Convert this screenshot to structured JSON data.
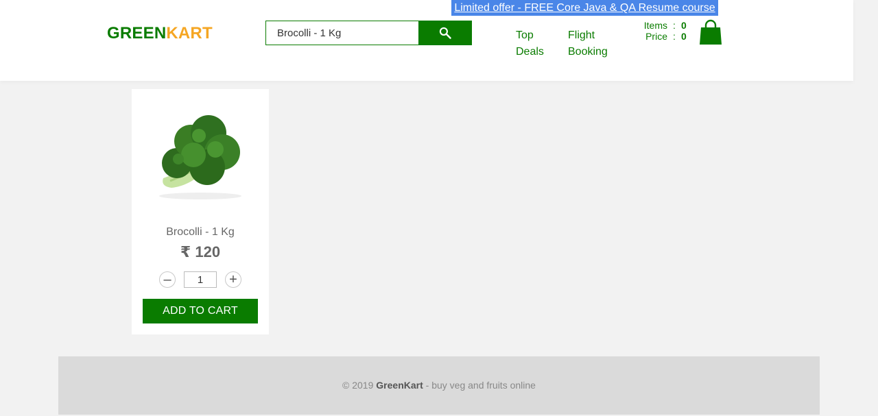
{
  "offer": {
    "text": "Limited offer - FREE Core Java & QA Resume course"
  },
  "brand": {
    "green": "GREEN",
    "kart": "KART",
    "colors": {
      "green": "#0a7c00",
      "orange": "#f5a623"
    }
  },
  "search": {
    "value": "Brocolli - 1 Kg",
    "placeholder": "Search for Vegetables and Fruits",
    "icon": "search-icon"
  },
  "nav": {
    "top_deals_line1": "Top",
    "top_deals_line2": "Deals",
    "flight_line1": "Flight",
    "flight_line2": "Booking"
  },
  "cart": {
    "items_label": "Items",
    "items_value": "0",
    "price_label": "Price",
    "price_value": "0",
    "separator": ":",
    "icon": "shopping-bag-icon"
  },
  "product": {
    "name": "Brocolli - 1 Kg",
    "price": "₹ 120",
    "quantity": "1",
    "decrement": "–",
    "increment": "+",
    "add_to_cart": "ADD TO CART",
    "image": "broccoli-image"
  },
  "footer": {
    "prefix": "© 2019 ",
    "brand": "GreenKart",
    "suffix": " - buy veg and fruits online"
  }
}
